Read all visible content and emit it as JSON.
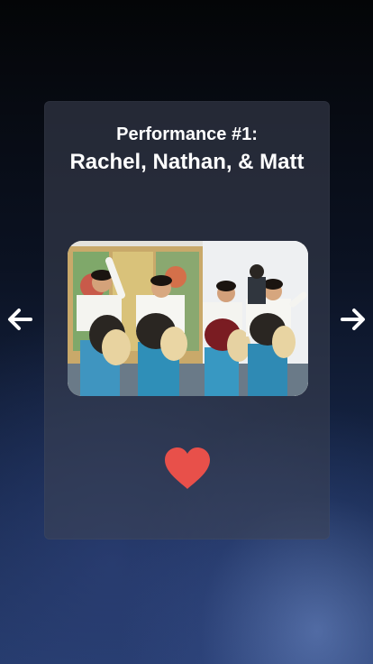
{
  "performance": {
    "number_label": "Performance #1:",
    "performers": "Rachel, Nathan, & Matt"
  },
  "navigation": {
    "prev_icon": "arrow-left-icon",
    "next_icon": "arrow-right-icon"
  },
  "like_icon": "heart-icon",
  "colors": {
    "heart": "#e8504a",
    "card_background": "#3e4454",
    "text": "#ffffff"
  }
}
